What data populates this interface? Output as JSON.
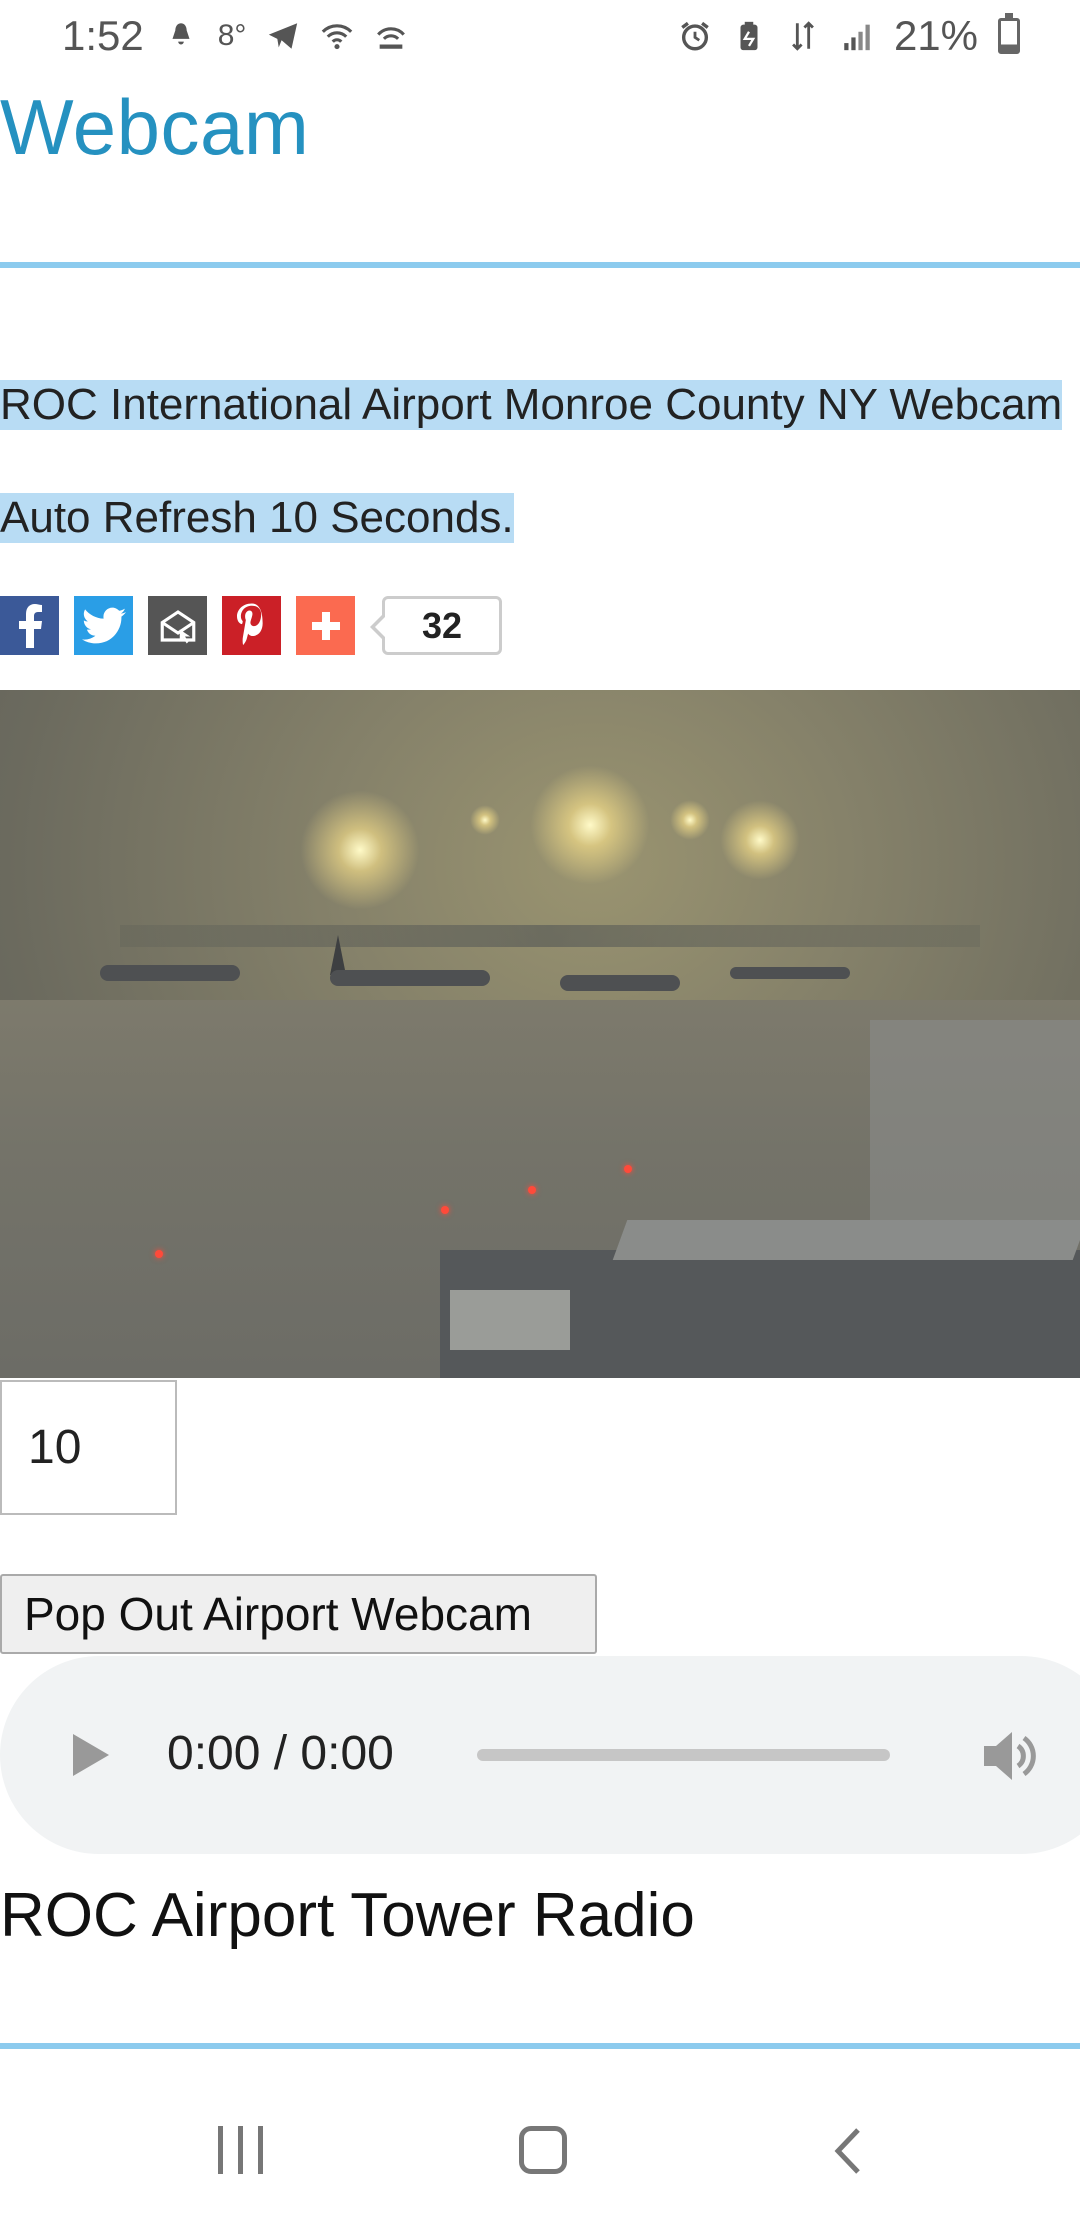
{
  "status_bar": {
    "time": "1:52",
    "temperature": "8°",
    "battery": "21%",
    "battery_level": 0.21,
    "icons_left": [
      "notification-icon",
      "telegram-icon",
      "wifi-icon",
      "hotspot-icon"
    ],
    "icons_right": [
      "alarm-icon",
      "battery-saver-icon",
      "lte-data-icon",
      "signal-icon",
      "battery-icon"
    ]
  },
  "page": {
    "title": "Webcam",
    "accent_color": "#2591c0",
    "rule_color": "#8ccbee",
    "highlight_color": "#b8dcf4"
  },
  "content": {
    "headline": "ROC International Airport Monroe County NY Webcam",
    "refresh_note": "Auto Refresh 10 Seconds."
  },
  "share": {
    "buttons": [
      {
        "name": "facebook",
        "label": "f",
        "color": "#3b5998"
      },
      {
        "name": "twitter",
        "label": "twitter",
        "color": "#2a9ee6"
      },
      {
        "name": "email",
        "label": "email",
        "color": "#555555"
      },
      {
        "name": "pinterest",
        "label": "p",
        "color": "#cb2027"
      },
      {
        "name": "more",
        "label": "+",
        "color": "#fb6a50"
      }
    ],
    "count": "32"
  },
  "webcam": {
    "alt": "Airport webcam image"
  },
  "refresh_input": {
    "value": "10"
  },
  "popout_button": {
    "label": "Pop Out Airport Webcam"
  },
  "audio": {
    "time": "0:00 / 0:00",
    "progress": 0
  },
  "radio": {
    "title": "ROC Airport Tower Radio"
  },
  "nav": {
    "items": [
      "recents-button",
      "home-button",
      "back-button"
    ]
  }
}
